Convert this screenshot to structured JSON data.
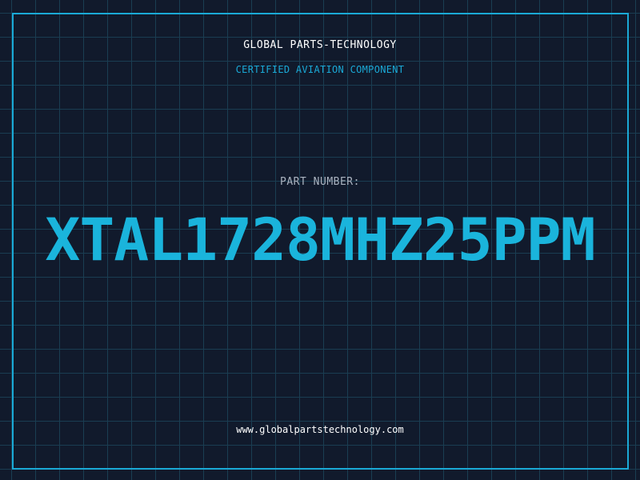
{
  "header": {
    "company": "GLOBAL PARTS-TECHNOLOGY",
    "subtitle": "CERTIFIED AVIATION COMPONENT"
  },
  "part": {
    "label": "PART NUMBER:",
    "number": "XTAL1728MHZ25PPM"
  },
  "footer": {
    "website": "www.globalpartstechnology.com"
  },
  "colors": {
    "background": "#111a2c",
    "grid": "#1a3d52",
    "accent": "#1ab4dc",
    "text": "#ffffff",
    "muted": "#aab3c0"
  }
}
